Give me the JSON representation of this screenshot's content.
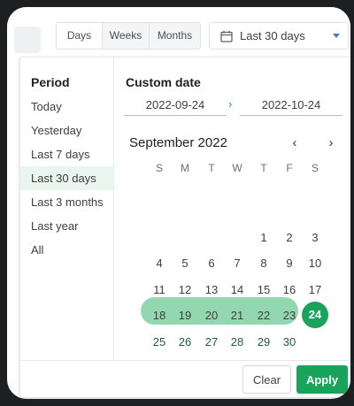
{
  "toolbar": {
    "granularity": {
      "days": "Days",
      "weeks": "Weeks",
      "months": "Months"
    },
    "range_select": {
      "value": "Last 30 days",
      "icon": "calendar-icon",
      "caret_icon": "caret-down-icon"
    }
  },
  "period": {
    "title": "Period",
    "items": [
      "Today",
      "Yesterday",
      "Last 7 days",
      "Last 30 days",
      "Last 3 months",
      "Last year",
      "All"
    ],
    "active_index": 3
  },
  "custom_date": {
    "title": "Custom date",
    "start": "2022-09-24",
    "end": "2022-10-24",
    "separator": "›"
  },
  "calendar": {
    "month_label": "September 2022",
    "prev": "‹",
    "next": "›",
    "weekdays": [
      "S",
      "M",
      "T",
      "W",
      "T",
      "F",
      "S"
    ],
    "weeks": [
      [
        "",
        "",
        "",
        "",
        "1",
        "2",
        "3"
      ],
      [
        "4",
        "5",
        "6",
        "7",
        "8",
        "9",
        "10"
      ],
      [
        "11",
        "12",
        "13",
        "14",
        "15",
        "16",
        "17"
      ],
      [
        "18",
        "19",
        "20",
        "21",
        "22",
        "23",
        "24"
      ],
      [
        "25",
        "26",
        "27",
        "28",
        "29",
        "30",
        ""
      ]
    ],
    "selected_day": "24",
    "in_range_days": [
      "25",
      "26",
      "27",
      "28",
      "29",
      "30"
    ]
  },
  "footer": {
    "clear": "Clear",
    "apply": "Apply"
  },
  "colors": {
    "accent": "#19a35b",
    "range": "#93d7b1",
    "active_bg": "#e9f5ee"
  }
}
